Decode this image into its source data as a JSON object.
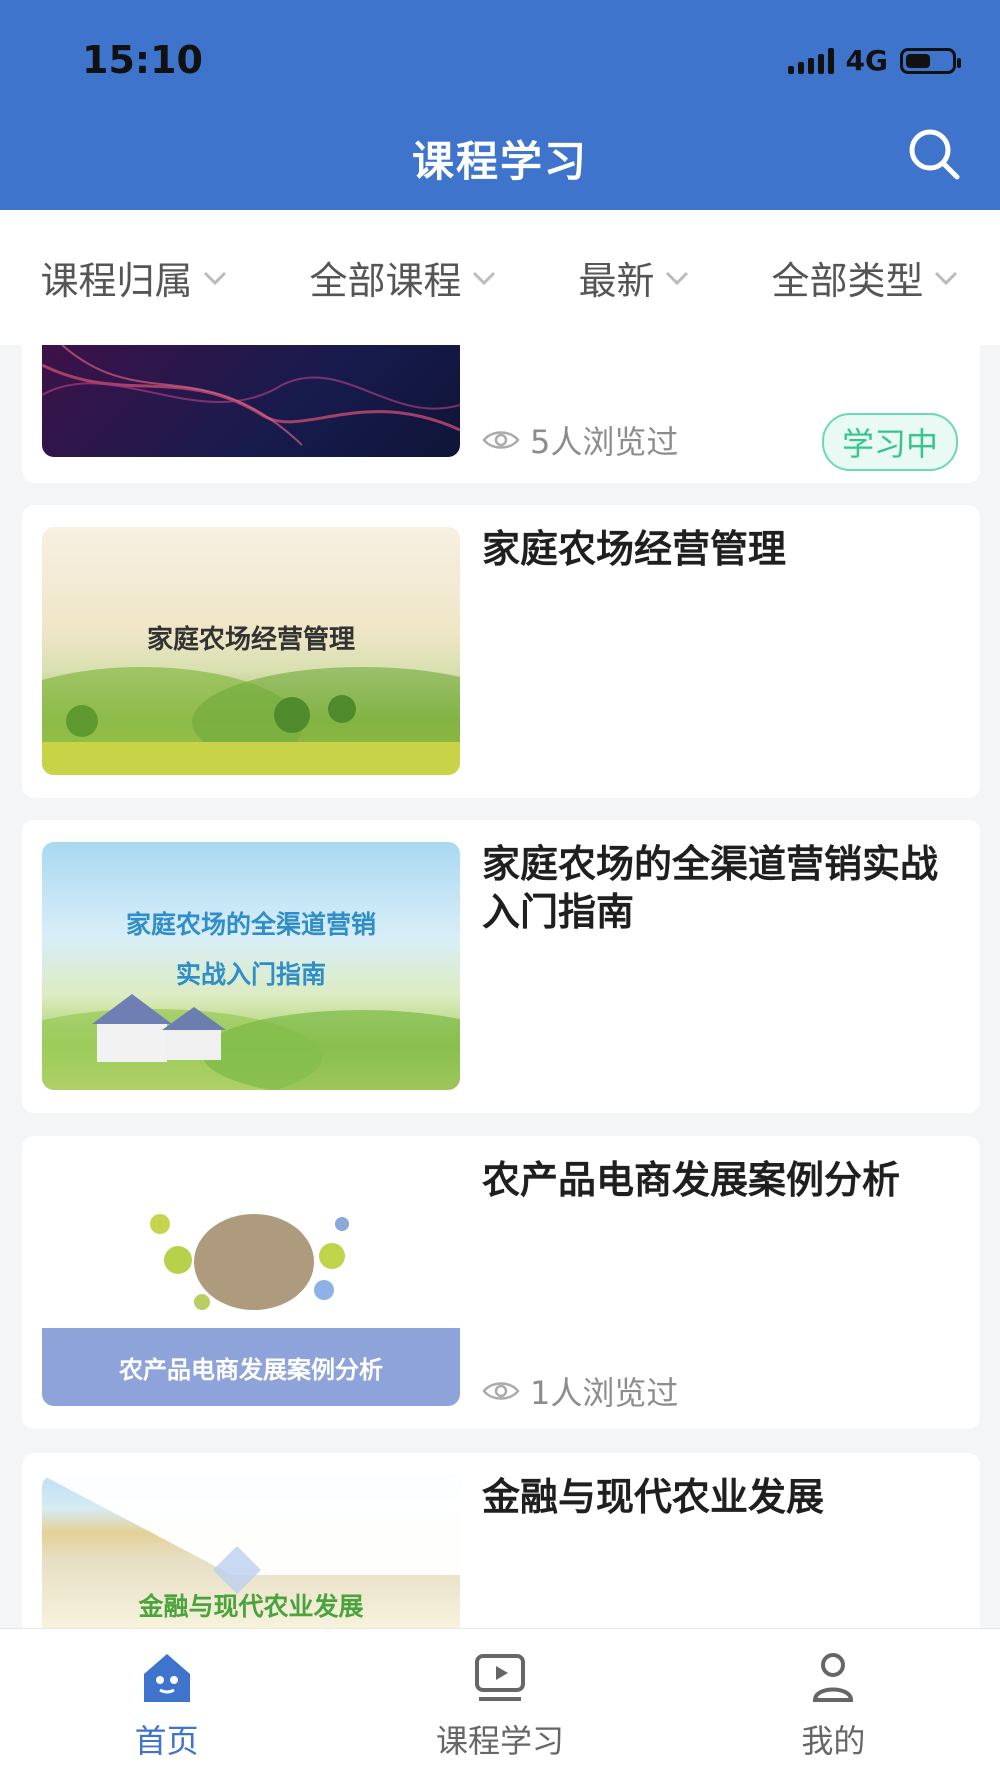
{
  "status": {
    "time": "15:10",
    "network": "4G"
  },
  "header": {
    "title": "课程学习"
  },
  "filters": [
    {
      "label": "课程归属"
    },
    {
      "label": "全部课程"
    },
    {
      "label": "最新"
    },
    {
      "label": "全部类型"
    }
  ],
  "courses": [
    {
      "title": "",
      "thumb_text": "",
      "views": "5人浏览过",
      "badge": "学习中"
    },
    {
      "title": "家庭农场经营管理",
      "thumb_text": "家庭农场经营管理",
      "views": "",
      "badge": ""
    },
    {
      "title": "家庭农场的全渠道营销实战入门指南",
      "thumb_text": "家庭农场的全渠道营销\n实战入门指南",
      "views": "",
      "badge": ""
    },
    {
      "title": "农产品电商发展案例分析",
      "thumb_text": "农产品电商发展案例分析",
      "views": "1人浏览过",
      "badge": ""
    },
    {
      "title": "金融与现代农业发展",
      "thumb_text": "金融与现代农业发展",
      "views": "",
      "badge": ""
    }
  ],
  "tabs": [
    {
      "label": "首页",
      "icon": "home-icon",
      "active": true
    },
    {
      "label": "课程学习",
      "icon": "play-icon",
      "active": false
    },
    {
      "label": "我的",
      "icon": "user-icon",
      "active": false
    }
  ],
  "colors": {
    "primary": "#3f74cc",
    "badge": "#37c48f"
  }
}
